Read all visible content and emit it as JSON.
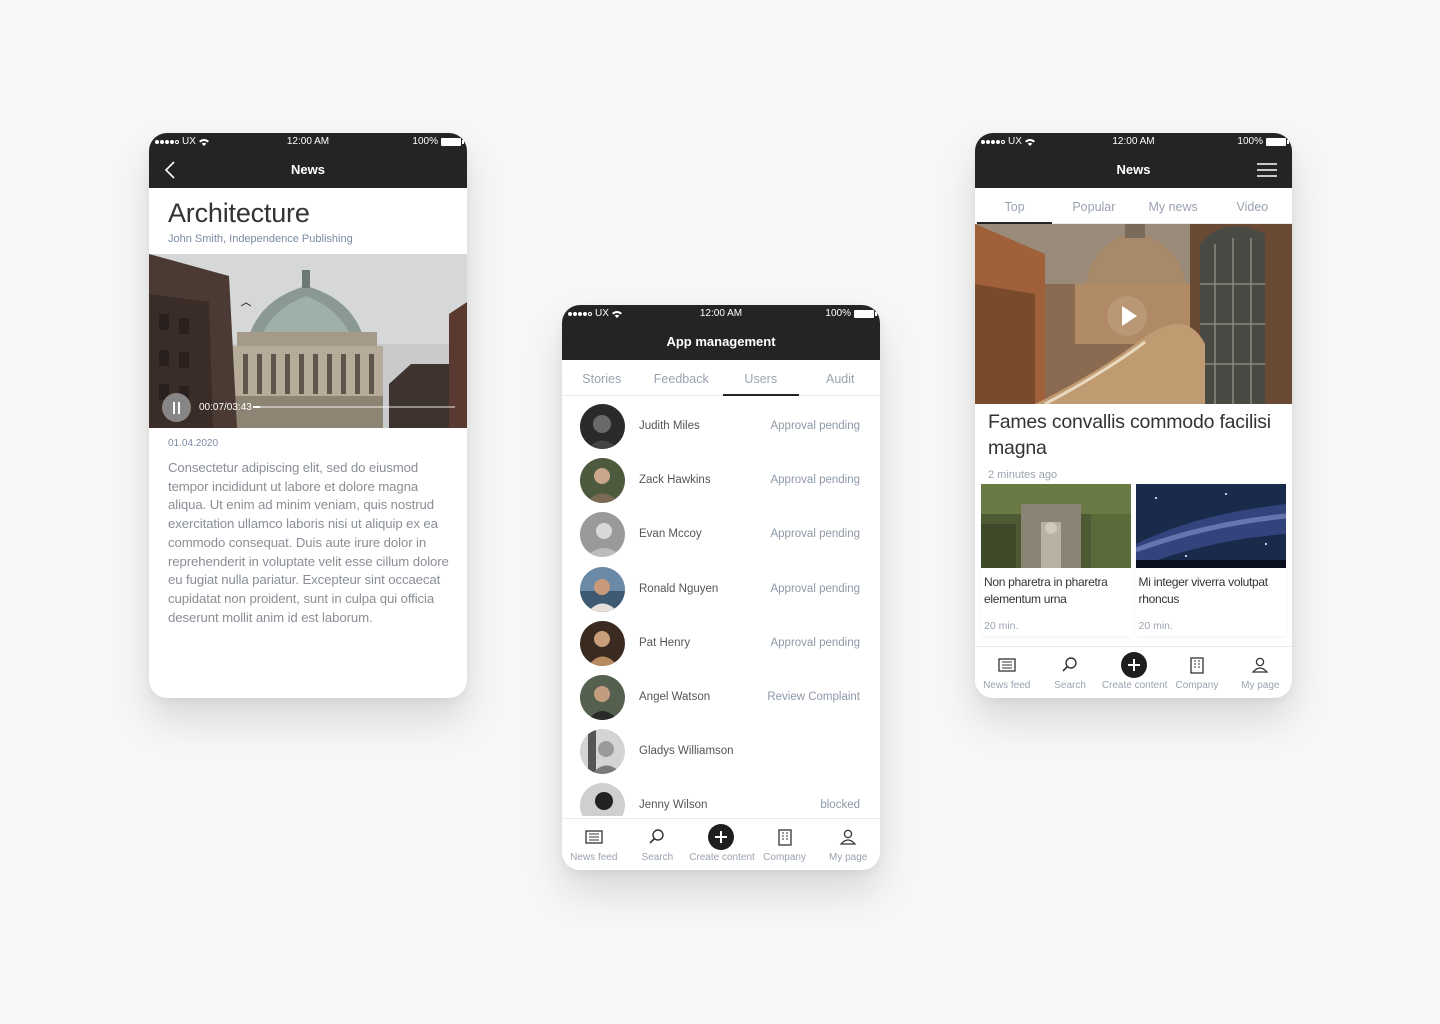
{
  "status_bar": {
    "carrier": "UX",
    "time": "12:00 AM",
    "battery": "100%"
  },
  "article_screen": {
    "nav_title": "News",
    "title": "Architecture",
    "byline": "John Smith, Independence Publishing",
    "video_time": "00:07/03:43",
    "video_progress": 0.035,
    "date": "01.04.2020",
    "body": "Consectetur adipiscing elit, sed do eiusmod tempor incididunt ut labore et dolore magna aliqua. Ut enim ad minim veniam, quis nostrud exercitation ullamco laboris nisi ut aliquip ex ea commodo consequat. Duis aute irure dolor in reprehenderit in voluptate velit esse cillum dolore eu fugiat nulla pariatur. Excepteur sint occaecat cupidatat non proident, sunt in culpa qui officia deserunt mollit anim id est laborum."
  },
  "users_screen": {
    "nav_title": "App management",
    "tabs": [
      {
        "label": "Stories"
      },
      {
        "label": "Feedback"
      },
      {
        "label": "Users"
      },
      {
        "label": "Audit"
      }
    ],
    "active_tab": "Users",
    "users": [
      {
        "name": "Judith Miles",
        "status": "Approval pending"
      },
      {
        "name": "Zack Hawkins",
        "status": "Approval pending"
      },
      {
        "name": "Evan Mccoy",
        "status": "Approval pending"
      },
      {
        "name": "Ronald Nguyen",
        "status": "Approval pending"
      },
      {
        "name": "Pat Henry",
        "status": "Approval pending"
      },
      {
        "name": "Angel Watson",
        "status": "Review Complaint"
      },
      {
        "name": "Gladys Williamson",
        "status": ""
      },
      {
        "name": "Jenny Wilson",
        "status": "blocked"
      }
    ]
  },
  "news_screen": {
    "nav_title": "News",
    "tabs": [
      {
        "label": "Top"
      },
      {
        "label": "Popular"
      },
      {
        "label": "My news"
      },
      {
        "label": "Video"
      }
    ],
    "active_tab": "Top",
    "hero_title": "Fames convallis commodo facilisi magna",
    "hero_time": "2 minutes ago",
    "cards": [
      {
        "title": "Non pharetra in pharetra elementum urna",
        "time": "20 min."
      },
      {
        "title": "Mi integer viverra volutpat rhoncus",
        "time": "20 min."
      }
    ]
  },
  "bottom_bar": [
    {
      "label": "News feed",
      "icon": "newspaper-icon"
    },
    {
      "label": "Search",
      "icon": "search-icon"
    },
    {
      "label": "Create content",
      "icon": "plus-icon"
    },
    {
      "label": "Company",
      "icon": "building-icon"
    },
    {
      "label": "My page",
      "icon": "user-icon"
    }
  ],
  "colors": {
    "header": "#242424",
    "muted_text": "#9aa3b0",
    "body_text": "#8a8f96",
    "background": "#f6f7f6"
  }
}
